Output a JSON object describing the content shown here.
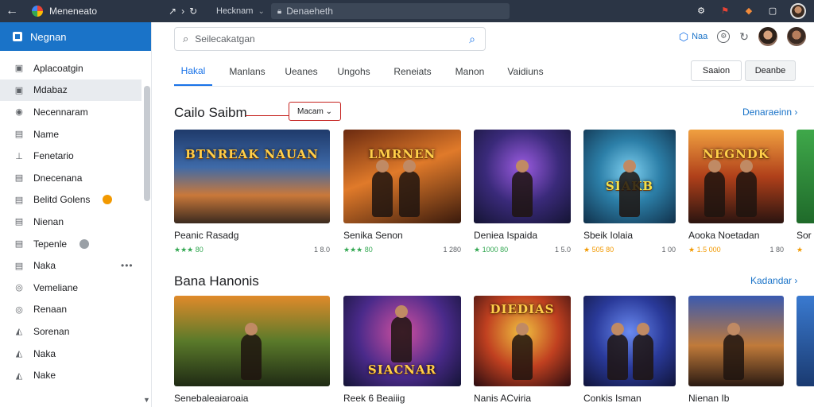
{
  "browser": {
    "tab_title": "Meneneato",
    "nav": [
      "↗",
      "›",
      "↻"
    ],
    "url_prefix": "Hecknam",
    "url": "Denaeheth",
    "right_icons": [
      "gear-icon",
      "flag-icon",
      "shield-icon",
      "window-icon"
    ]
  },
  "sidebar": {
    "title": "Negnan",
    "items": [
      {
        "label": "Aplacoatgin",
        "icon": "▣"
      },
      {
        "label": "Mdabaz",
        "icon": "▣"
      },
      {
        "label": "Necennaram",
        "icon": "◉"
      },
      {
        "label": "Name",
        "icon": "▤"
      },
      {
        "label": "Fenetario",
        "icon": "⊥"
      },
      {
        "label": "Dnecenana",
        "icon": "▤"
      },
      {
        "label": "Belitd Golens",
        "icon": "▤"
      },
      {
        "label": "Nienan",
        "icon": "▤"
      },
      {
        "label": "Tepenle",
        "icon": "▤"
      },
      {
        "label": "Naka",
        "icon": "▤"
      },
      {
        "label": "Vemeliane",
        "icon": "◎"
      },
      {
        "label": "Renaan",
        "icon": "◎"
      },
      {
        "label": "Sorenan",
        "icon": "◭"
      },
      {
        "label": "Naka",
        "icon": "◭"
      },
      {
        "label": "Nake",
        "icon": "◭"
      }
    ],
    "more": "•••"
  },
  "search": {
    "placeholder": "Seilecakatgan"
  },
  "header_right": {
    "label": "Naa"
  },
  "tabs": [
    "Hakal",
    "Manlans",
    "Ueanes",
    "Ungohs",
    "Reneiats",
    "Manon",
    "Vaidiuns"
  ],
  "buttons": {
    "primary": "Saaion",
    "secondary": "Deanbe"
  },
  "section1": {
    "title": "Cailo Saibm",
    "filter": "Macam ⌄",
    "see_all": "Denaraeinn ›",
    "cards": [
      {
        "name": "Peanic Rasadg",
        "rating": "★★★ 80",
        "count": "1 8.0",
        "art": "BTNREAK NAUAN",
        "stars_color": "green"
      },
      {
        "name": "Senika Senon",
        "rating": "★★★ 80",
        "count": "1 280",
        "art": "LMRNEN",
        "stars_color": "green"
      },
      {
        "name": "Deniea Ispaida",
        "rating": "★ 1000 80",
        "count": "1 5.0",
        "art": "",
        "stars_color": "green"
      },
      {
        "name": "Sbeik Iolaia",
        "rating": "★ 505 80",
        "count": "1 00",
        "art": "SIAKB",
        "stars_color": "orange"
      },
      {
        "name": "Aooka Noetadan",
        "rating": "★ 1.5 000",
        "count": "1 80",
        "art": "NEGNDK",
        "stars_color": "orange"
      },
      {
        "name": "Sor",
        "rating": "★",
        "count": "",
        "art": "",
        "stars_color": "green"
      }
    ]
  },
  "section2": {
    "title": "Bana Hanonis",
    "see_all": "Kadandar ›",
    "cards": [
      {
        "name": "Senebaleaiaroaia",
        "art": ""
      },
      {
        "name": "Reek 6 Beaiiig",
        "art": "SIACNAR"
      },
      {
        "name": "Nanis ACviria",
        "art": "DIEDIAS"
      },
      {
        "name": "Conkis Isman",
        "art": ""
      },
      {
        "name": "Nienan Ib",
        "art": ""
      },
      {
        "name": "",
        "art": ""
      }
    ]
  },
  "colors": {
    "accent": "#1a73e8",
    "topbar": "#2b3545",
    "sidebar_header": "#1a73c8",
    "filter_border": "#c5221f"
  }
}
